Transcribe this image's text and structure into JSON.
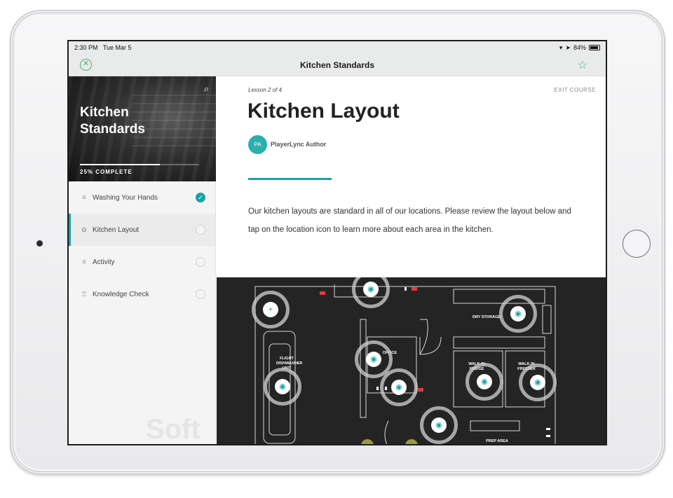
{
  "status_bar": {
    "time": "2:30 PM",
    "date": "Tue Mar 5",
    "battery": "84%"
  },
  "nav": {
    "title": "Kitchen Standards",
    "close_icon": "close-circle-icon",
    "star_icon": "star-icon"
  },
  "sidebar": {
    "course_title": "Kitchen Standards",
    "progress_text": "25% COMPLETE",
    "progress": 0.67,
    "items": [
      {
        "label": "Washing Your Hands",
        "icon": "lines-icon",
        "status": "complete"
      },
      {
        "label": "Kitchen Layout",
        "icon": "person-icon",
        "status": "active"
      },
      {
        "label": "Activity",
        "icon": "lines-icon",
        "status": "incomplete"
      },
      {
        "label": "Knowledge Check",
        "icon": "question-icon",
        "status": "incomplete"
      }
    ],
    "watermark": "Soft"
  },
  "main": {
    "lesson_count": "Lesson 2 of 4",
    "exit_label": "EXIT COURSE",
    "title": "Kitchen Layout",
    "author_initials": "PA",
    "author_name": "PlayerLync Author",
    "body": "Our kitchen layouts are standard in all of our locations. Please review the layout below and tap on the location icon to learn more about each area in the kitchen."
  },
  "floor_plan": {
    "labels": {
      "dry_storage": "DRY STORAGE",
      "office": "OFFICE",
      "flight_dishwasher": "FLIGHT DISHWASHER UNIT",
      "walkin_fridge": "WALK-IN FRIDGE",
      "walkin_freezer": "WALK-IN FREEZER",
      "prep_area": "PREP AREA"
    },
    "accent_color": "#1aa3a3"
  }
}
